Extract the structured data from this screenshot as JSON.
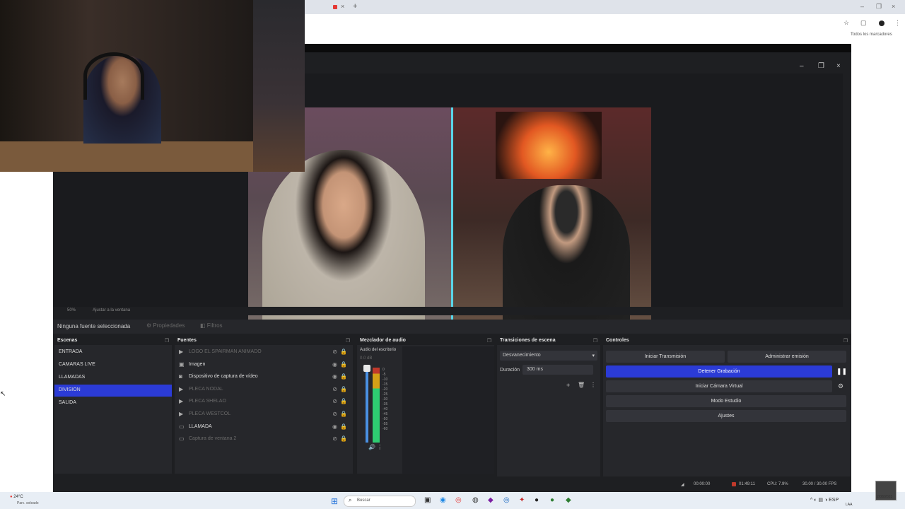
{
  "browser": {
    "new_tab": "+",
    "close_tab": "×",
    "minimize": "–",
    "maximize": "❐",
    "close": "×",
    "bookmarks": "Todos los marcadores"
  },
  "obs": {
    "window_controls": {
      "minimize": "–",
      "maximize": "❐",
      "close": "×"
    },
    "preview_toolbar": {
      "zoom": "50%",
      "fit": "Ajustar a la ventana"
    },
    "source_bar": {
      "no_source": "Ninguna fuente seleccionada",
      "properties": "Propiedades",
      "filters": "Filtros"
    },
    "scenes": {
      "title": "Escenas",
      "items": [
        {
          "label": "ENTRADA"
        },
        {
          "label": "CAMARAS LIVE"
        },
        {
          "label": "LLAMADAS"
        },
        {
          "label": "DIVISION"
        },
        {
          "label": "SALIDA"
        }
      ],
      "selected_index": 3
    },
    "sources": {
      "title": "Fuentes",
      "items": [
        {
          "label": "LOGO EL SPAIRMAN ANIMADO",
          "icon": "play-icon",
          "visible": false
        },
        {
          "label": "Imagen",
          "icon": "image-icon",
          "visible": true
        },
        {
          "label": "Dispositivo de captura de vídeo",
          "icon": "camera-icon",
          "visible": true
        },
        {
          "label": "PLECA NODAL",
          "icon": "play-icon",
          "visible": false
        },
        {
          "label": "PLECA SHELAO",
          "icon": "play-icon",
          "visible": false
        },
        {
          "label": "PLECA WESTCOL",
          "icon": "play-icon",
          "visible": false
        },
        {
          "label": "LLAMADA",
          "icon": "window-icon",
          "visible": true
        },
        {
          "label": "Captura de ventana 2",
          "icon": "window-icon",
          "visible": false
        }
      ]
    },
    "mixer": {
      "title": "Mezclador de audio",
      "channel": "Audio del escritorio",
      "db": "0.0 dB",
      "scale": [
        "0",
        "-5",
        "-10",
        "-15",
        "-20",
        "-25",
        "-30",
        "-35",
        "-40",
        "-45",
        "-50",
        "-55",
        "-60"
      ]
    },
    "transitions": {
      "title": "Transiciones de escena",
      "selected": "Desvanecimiento",
      "duration_label": "Duración",
      "duration_value": "300 ms"
    },
    "controls": {
      "title": "Controles",
      "start_stream": "Iniciar Transmisión",
      "manage_stream": "Administrar emisión",
      "stop_recording": "Detener Grabación",
      "virtual_camera": "Iniciar Cámara Virtual",
      "studio_mode": "Modo Estudio",
      "settings": "Ajustes"
    },
    "status": {
      "stream_time": "00:00:00",
      "rec_time": "01:49:11",
      "cpu": "CPU: 7.9%",
      "fps": "30.00 / 30.00 FPS"
    }
  },
  "taskbar": {
    "weather_temp": "24°C",
    "weather_desc": "Parc. soleado",
    "search": "Buscar",
    "language": "ESP",
    "language2": "LAA",
    "time": "",
    "date": "2/08/2023"
  },
  "colors": {
    "accent": "#2b3bd6",
    "panel": "#26272b",
    "background": "#1e1f22"
  }
}
